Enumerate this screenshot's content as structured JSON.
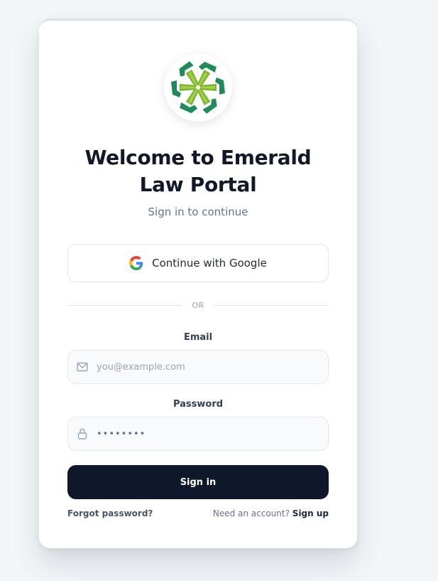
{
  "brand": {
    "logo_icon": "emerald-pinwheel-logo-icon",
    "primary_color": "#0f172a",
    "accent_green": "#2e8b57"
  },
  "header": {
    "title": "Welcome to Emerald Law Portal",
    "subtitle": "Sign in to continue"
  },
  "google_button": {
    "icon": "google-icon",
    "label": "Continue with Google"
  },
  "divider": {
    "text": "OR"
  },
  "email": {
    "label": "Email",
    "icon": "mail-icon",
    "placeholder": "you@example.com",
    "value": ""
  },
  "password": {
    "label": "Password",
    "icon": "lock-icon",
    "value": "••••••••"
  },
  "signin_button": {
    "label": "Sign in"
  },
  "footer": {
    "forgot_label": "Forgot password?",
    "need_account_text": "Need an account?",
    "signup_label": "Sign up"
  }
}
